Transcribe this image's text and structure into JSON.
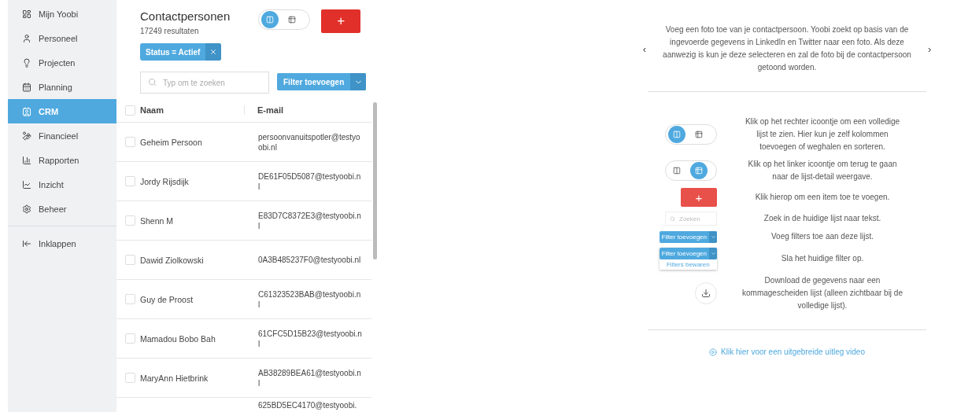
{
  "sidebar": {
    "items": [
      {
        "label": "Mijn Yoobi",
        "selected": false
      },
      {
        "label": "Personeel",
        "selected": false
      },
      {
        "label": "Projecten",
        "selected": false
      },
      {
        "label": "Planning",
        "selected": false
      },
      {
        "label": "CRM",
        "selected": true
      },
      {
        "label": "Financieel",
        "selected": false
      },
      {
        "label": "Rapporten",
        "selected": false
      },
      {
        "label": "Inzicht",
        "selected": false
      },
      {
        "label": "Beheer",
        "selected": false
      }
    ],
    "collapse": "Inklappen"
  },
  "list": {
    "title": "Contactpersonen",
    "count": "17249 resultaten",
    "view_toggle": [
      {
        "selected": true
      },
      {
        "selected": false
      }
    ],
    "select_all_checked": false,
    "add_button": "+",
    "filter_chip": "Status = Actief",
    "search": {
      "placeholder": "Typ om te zoeken"
    },
    "filter_button": "Filter toevoegen",
    "columns": [
      "Naam",
      "E-mail"
    ],
    "rows": [
      {
        "name": "Geheim Persoon",
        "email": "persoonvanuitspotler@testyoobi.nl",
        "checked": false
      },
      {
        "name": "Jordy Rijsdijk",
        "email": "DE61F05D5087@testyoobi.nl",
        "checked": false
      },
      {
        "name": "Shenn M",
        "email": "E83D7C8372E3@testyoobi.nl",
        "checked": false
      },
      {
        "name": "Dawid Ziolkowski",
        "email": "0A3B485237F0@testyoobi.nl",
        "checked": false
      },
      {
        "name": "Guy de Proost",
        "email": "C61323523BAB@testyoobi.nl",
        "checked": false
      },
      {
        "name": "Mamadou Bobo Bah",
        "email": "61CFC5D15B23@testyoobi.nl",
        "checked": false
      },
      {
        "name": "MaryAnn Hietbrink",
        "email": "AB38289BEA61@testyoobi.nl",
        "checked": false
      },
      {
        "email": "625BD5EC4170@testyoobi."
      }
    ]
  },
  "help": {
    "carousel_text": "Voeg een foto toe van je contactpersoon. Yoobi zoekt op basis van de ingevoerde gegevens in LinkedIn en Twitter naar een foto. Als deze aanwezig is kun je deze selecteren en zal de foto bij de contactpersoon getoond worden.",
    "prev": "‹",
    "next": "›",
    "tips": [
      {
        "kind": "toggle",
        "toggle": [
          {
            "selected": true
          },
          {
            "selected": false
          }
        ],
        "text": "Klik op het rechter icoontje om een volledige lijst te zien. Hier kun je zelf kolommen toevoegen of weghalen en sorteren."
      },
      {
        "kind": "toggle",
        "toggle": [
          {
            "selected": false
          },
          {
            "selected": true
          }
        ],
        "text": "Klik op het linker icoontje om terug te gaan naar de lijst-detail weergave."
      },
      {
        "kind": "add",
        "label": "+",
        "text": "Klik hierop om een item toe te voegen."
      },
      {
        "kind": "search",
        "label": "Zoeken",
        "text": "Zoek in de huidige lijst naar tekst."
      },
      {
        "kind": "filter",
        "label": "Filter toevoegen",
        "text": "Voeg filters toe aan deze lijst."
      },
      {
        "kind": "save_filter",
        "label": "Filter toevoegen",
        "sublabel": "Filters bewaren",
        "text": "Sla het huidige filter op."
      },
      {
        "kind": "download",
        "text": "Download de gegevens naar een kommagescheiden lijst (alleen zichtbaar bij de volledige lijst)."
      }
    ],
    "video_link": "Klik hier voor een uitgebreide uitleg video"
  }
}
